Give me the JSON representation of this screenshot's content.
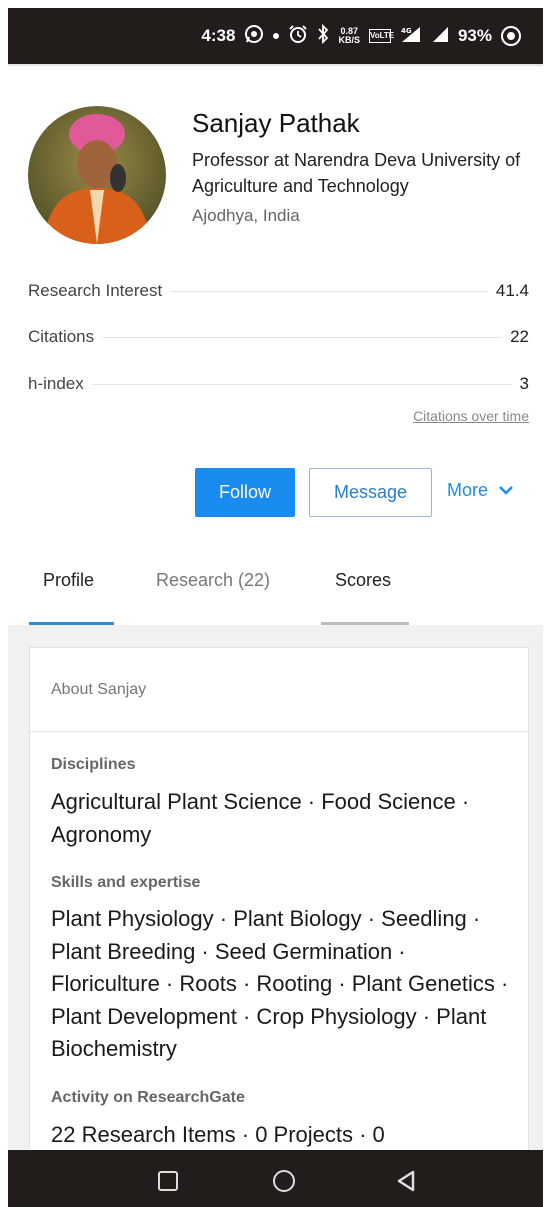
{
  "status_bar": {
    "time": "4:38",
    "net_speed_top": "0.87",
    "net_speed_unit": "KB/S",
    "volte": "VoLTE",
    "lte": "4G",
    "battery": "93%"
  },
  "profile": {
    "name": "Sanjay Pathak",
    "title": "Professor at Narendra Deva University of Agriculture and Technology",
    "location": "Ajodhya, India"
  },
  "metrics": [
    {
      "label": "Research Interest",
      "value": "41.4"
    },
    {
      "label": "Citations",
      "value": "22"
    },
    {
      "label": "h-index",
      "value": "3"
    }
  ],
  "citations_link": "Citations over time",
  "actions": {
    "follow": "Follow",
    "message": "Message",
    "more": "More"
  },
  "tabs": [
    {
      "label": "Profile"
    },
    {
      "label": "Research (22)"
    },
    {
      "label": "Scores"
    }
  ],
  "about": {
    "heading": "About Sanjay",
    "disciplines_label": "Disciplines",
    "disciplines": "Agricultural Plant Science · Food Science · Agronomy",
    "skills_label": "Skills and expertise",
    "skills": "Plant Physiology · Plant Biology · Seedling · Plant Breeding · Seed Germination · Floriculture · Roots · Rooting · Plant Genetics · Plant Development · Crop Physiology · Plant Biochemistry",
    "activity_label": "Activity on ResearchGate",
    "activity": "22 Research Items · 0 Projects · 0"
  },
  "colors": {
    "accent": "#1a8cf0",
    "tab_active": "#2b8fd6",
    "status_bg": "#221d1a"
  },
  "icons": [
    "whatsapp-icon",
    "alarm-icon",
    "bluetooth-icon",
    "signal-icon",
    "target-icon",
    "chevron-down-icon",
    "nav-square-icon",
    "nav-circle-icon",
    "nav-back-icon"
  ]
}
